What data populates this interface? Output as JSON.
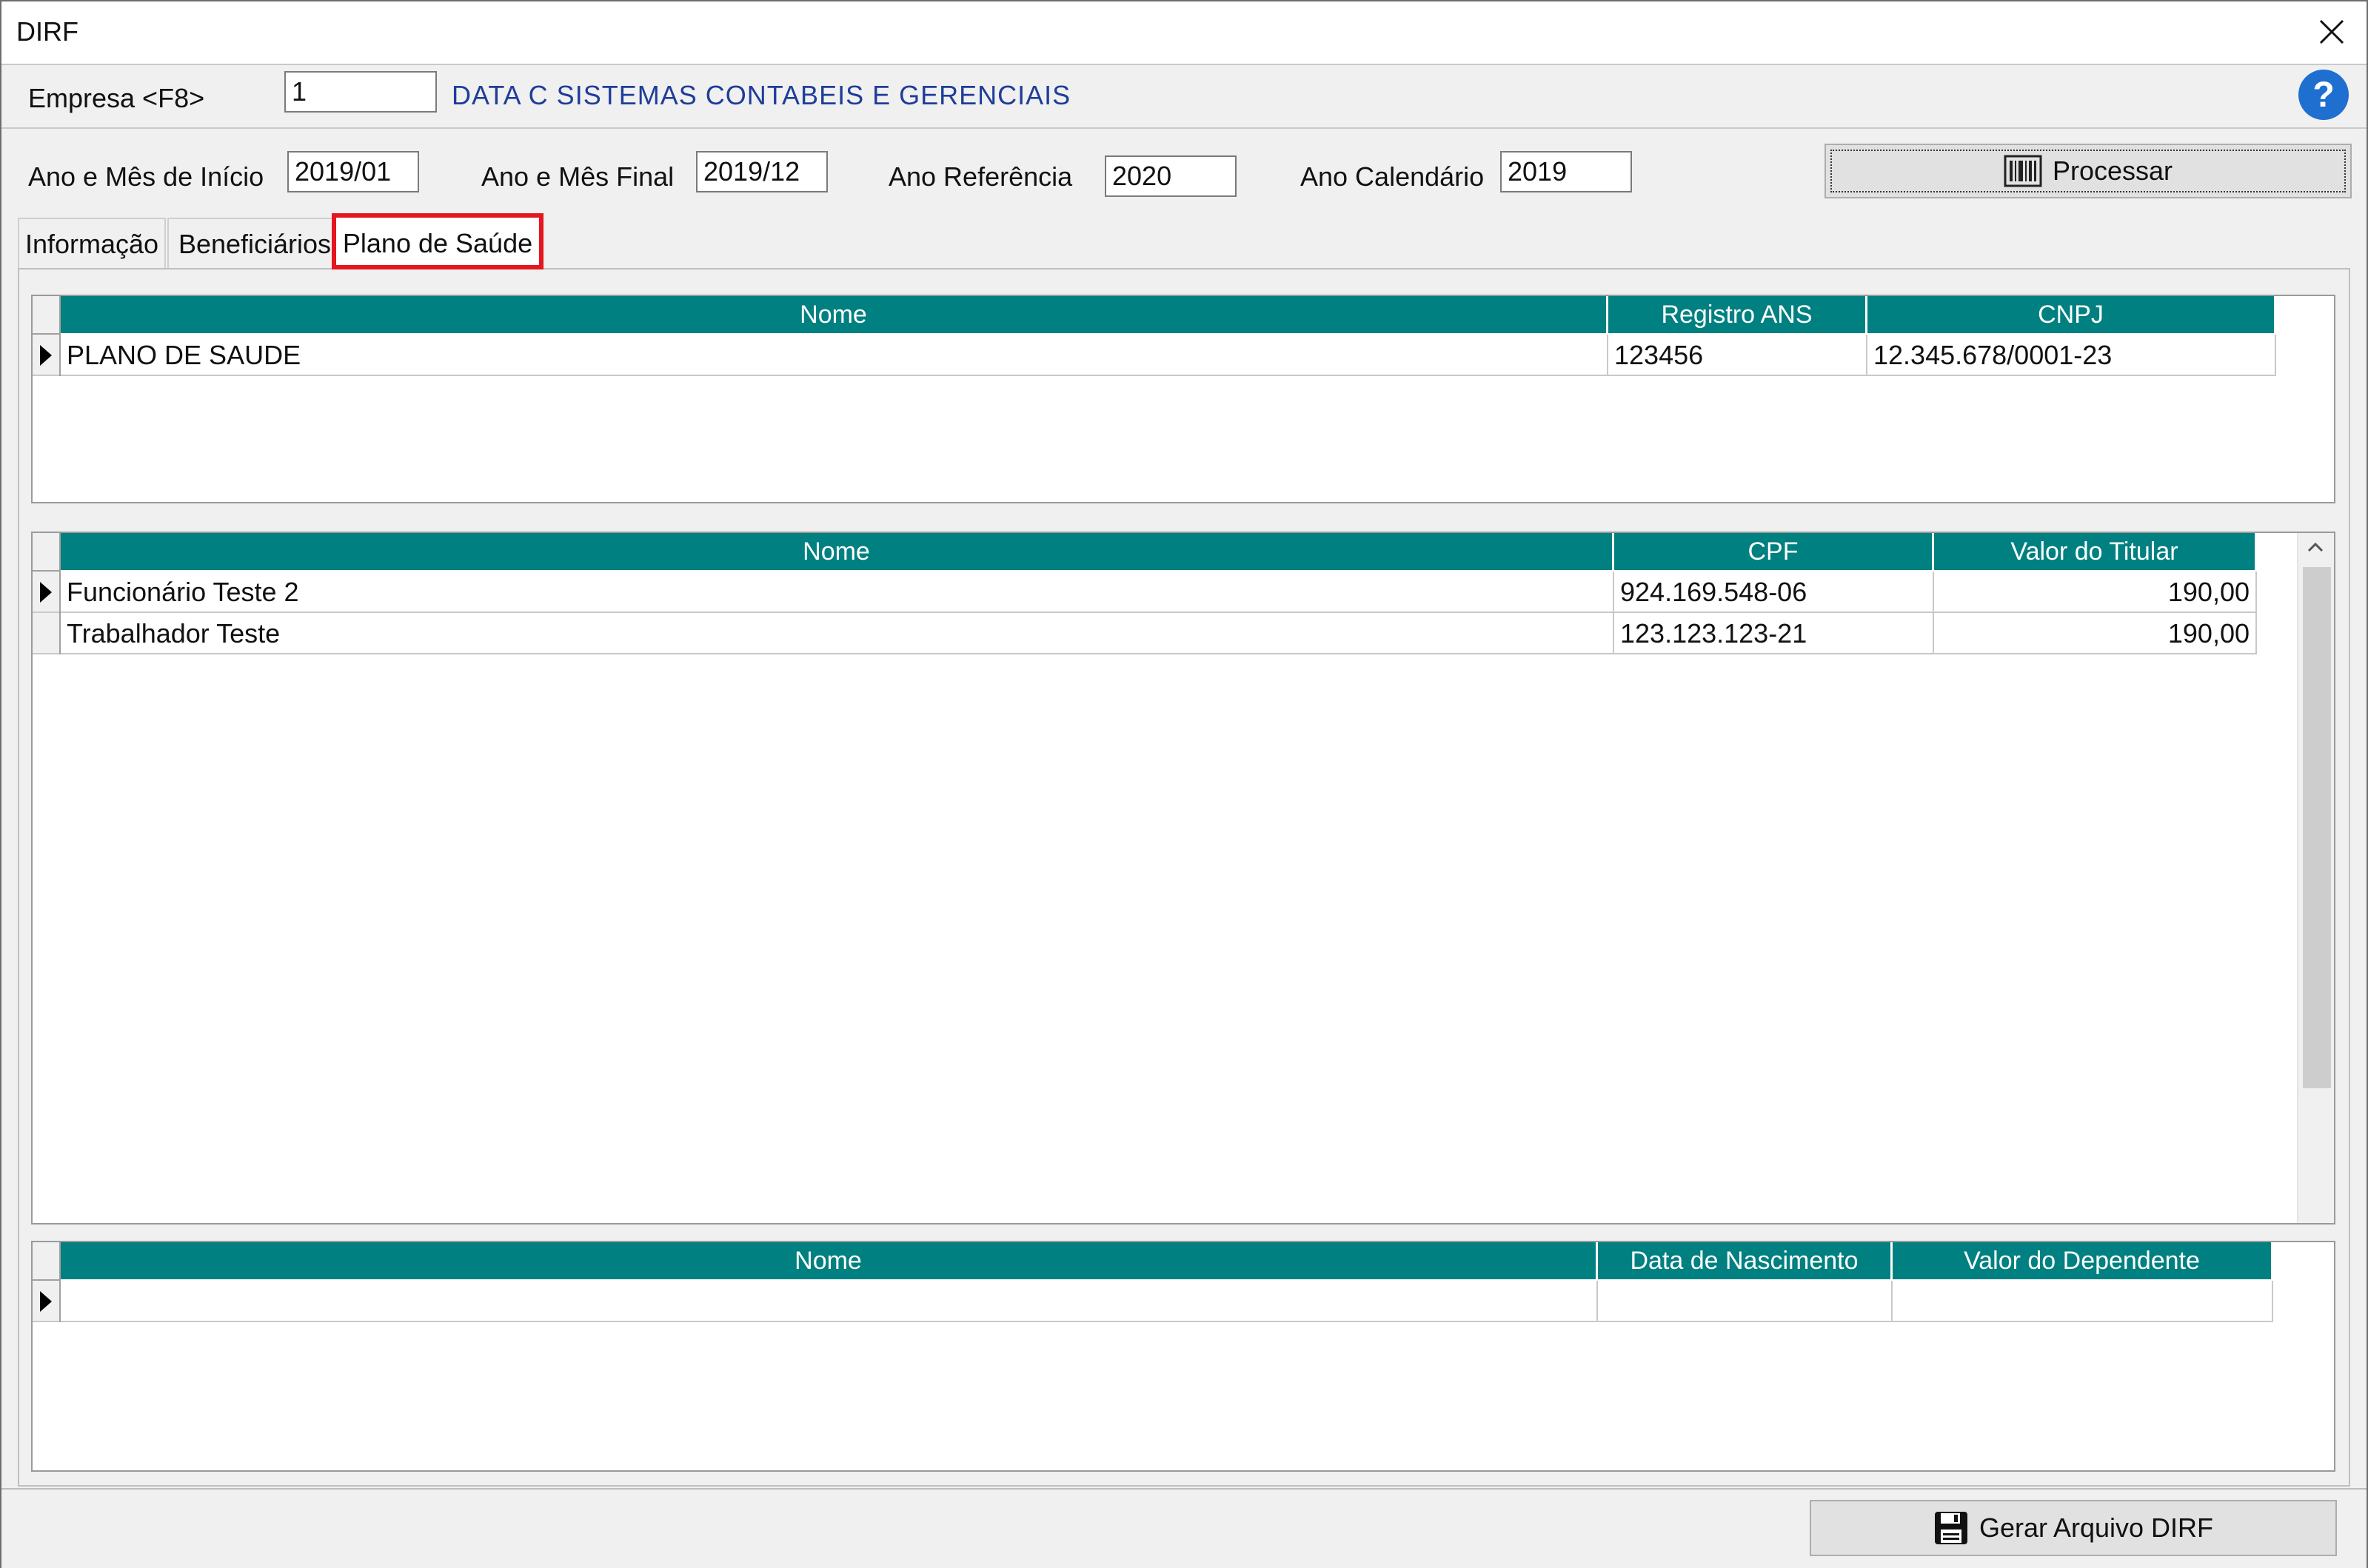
{
  "window": {
    "title": "DIRF"
  },
  "company": {
    "label": "Empresa <F8>",
    "code": "1",
    "name": "DATA C SISTEMAS CONTABEIS E GERENCIAIS"
  },
  "period": {
    "start_label": "Ano e Mês de Início",
    "start_value": "2019/01",
    "end_label": "Ano e Mês Final",
    "end_value": "2019/12",
    "ref_label": "Ano Referência",
    "ref_value": "2020",
    "cal_label": "Ano Calendário",
    "cal_value": "2019"
  },
  "buttons": {
    "process": "Processar",
    "generate": "Gerar Arquivo DIRF"
  },
  "tabs": [
    {
      "label": "Informação"
    },
    {
      "label": "Beneficiários"
    },
    {
      "label": "Plano de Saúde"
    }
  ],
  "plans_grid": {
    "columns": [
      "Nome",
      "Registro ANS",
      "CNPJ"
    ],
    "rows": [
      {
        "nome": "PLANO DE SAUDE",
        "registro": "123456",
        "cnpj": "12.345.678/0001-23"
      }
    ]
  },
  "holders_grid": {
    "columns": [
      "Nome",
      "CPF",
      "Valor do Titular"
    ],
    "rows": [
      {
        "nome": "Funcionário Teste 2",
        "cpf": "924.169.548-06",
        "valor": "190,00"
      },
      {
        "nome": "Trabalhador Teste",
        "cpf": "123.123.123-21",
        "valor": "190,00"
      }
    ]
  },
  "dependents_grid": {
    "columns": [
      "Nome",
      "Data de Nascimento",
      "Valor do Dependente"
    ],
    "rows": []
  },
  "icons": {
    "close": "close-icon",
    "help": "help-icon",
    "process": "barcode-icon",
    "save": "save-icon"
  },
  "colors": {
    "header": "#008080",
    "company_name": "#1f3d99",
    "tab_highlight": "#e4161f"
  }
}
